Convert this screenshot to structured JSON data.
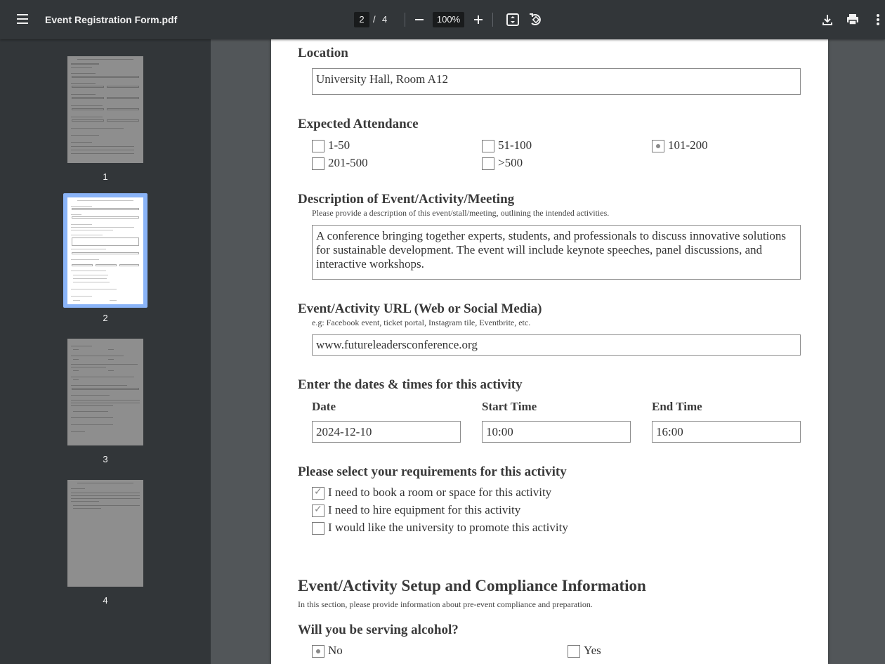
{
  "toolbar": {
    "menu_icon": "hamburger-menu-icon",
    "title": "Event Registration Form.pdf",
    "current_page": "2",
    "page_separator": "/",
    "total_pages": "4",
    "zoom": "100%",
    "icons": [
      "zoom-out-icon",
      "zoom-in-icon",
      "fit-page-icon",
      "rotate-icon",
      "download-icon",
      "print-icon",
      "more-options-icon"
    ]
  },
  "sidebar": {
    "thumbnails": [
      {
        "label": "1"
      },
      {
        "label": "2"
      },
      {
        "label": "3"
      },
      {
        "label": "4"
      }
    ],
    "selected": "2"
  },
  "form": {
    "location": {
      "label": "Location",
      "value": "University Hall, Room A12"
    },
    "attendance": {
      "label": "Expected Attendance",
      "options": [
        {
          "label": "1-50",
          "selected": false
        },
        {
          "label": "51-100",
          "selected": false
        },
        {
          "label": "101-200",
          "selected": true
        },
        {
          "label": "201-500",
          "selected": false
        },
        {
          "label": ">500",
          "selected": false
        }
      ]
    },
    "description": {
      "label": "Description of Event/Activity/Meeting",
      "hint": "Please provide a description of this event/stall/meeting, outlining the intended activities.",
      "value": "A conference bringing together experts, students, and professionals to discuss innovative solutions for sustainable development. The event will include keynote speeches, panel discussions, and interactive workshops."
    },
    "url": {
      "label": "Event/Activity URL (Web or Social Media)",
      "hint": "e.g: Facebook event, ticket portal, Instagram tile, Eventbrite, etc.",
      "value": "www.futureleadersconference.org"
    },
    "dates": {
      "label": "Enter the dates & times for this activity",
      "date_label": "Date",
      "start_label": "Start Time",
      "end_label": "End Time",
      "date_value": "2024-12-10",
      "start_value": "10:00",
      "end_value": "16:00"
    },
    "requirements": {
      "label": "Please select your requirements for this activity",
      "options": [
        {
          "label": "I need to book a room or space for this activity",
          "checked": true
        },
        {
          "label": "I need to hire equipment for this activity",
          "checked": true
        },
        {
          "label": "I would like the university to promote this activity",
          "checked": false
        }
      ]
    },
    "compliance": {
      "title": "Event/Activity Setup and Compliance Information",
      "hint": "In this section, please provide information about pre-event compliance and preparation."
    },
    "alcohol": {
      "label": "Will you be serving alcohol?",
      "options": [
        {
          "label": "No",
          "selected": true
        },
        {
          "label": "Yes",
          "selected": false
        }
      ]
    }
  }
}
